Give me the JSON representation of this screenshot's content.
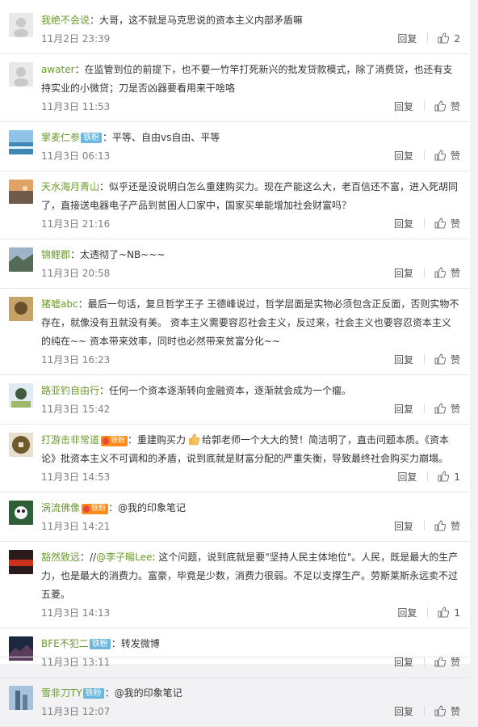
{
  "comments": [
    {
      "user": "我绝不会说",
      "badge": "",
      "vip": "",
      "text": "：大哥，这不就是马克思说的资本主义内部矛盾嘛",
      "time": "11月2日 23:39",
      "reply": "回复",
      "likes": "2"
    },
    {
      "user": "awater",
      "badge": "",
      "vip": "",
      "text": "：在监管到位的前提下，也不要一竹竿打死新兴的批发贷款模式，除了消费贷，也还有支持实业的小微贷；刀是否凶器要看用来干啥咯",
      "time": "11月3日 11:53",
      "reply": "回复",
      "likes": "赞"
    },
    {
      "user": "掌麦仁参",
      "badge": "铁粉",
      "vip": "",
      "text": "：平等、自由vs自由、平等",
      "time": "11月3日 06:13",
      "reply": "回复",
      "likes": "赞"
    },
    {
      "user": "天水海月青山",
      "badge": "",
      "vip": "",
      "text": "：似乎还是没说明白怎么重建购买力。现在产能这么大，老百信还不富，进入死胡同了，直接送电器电子产品到贫困人口家中，国家买单能增加社会财富吗？",
      "time": "11月3日 21:16",
      "reply": "回复",
      "likes": "赞"
    },
    {
      "user": "锦鲤郡",
      "badge": "",
      "vip": "",
      "text": "：太透彻了~NB~~~",
      "time": "11月3日 20:58",
      "reply": "回复",
      "likes": "赞"
    },
    {
      "user": "猪嘘abc",
      "badge": "",
      "vip": "",
      "text": "：最后一句话，复旦哲学王子 王德峰说过，哲学层面是实物必须包含正反面，否则实物不存在，就像没有丑就没有美。 资本主义需要容忍社会主义，反过来，社会主义也要容忍资本主义的纯在~~ 资本带来效率，同时也必然带来贫富分化~~",
      "time": "11月3日 16:23",
      "reply": "回复",
      "likes": "赞"
    },
    {
      "user": "路亚钓自由行",
      "badge": "",
      "vip": "",
      "text": "：任何一个资本逐渐转向金融资本，逐渐就会成为一个瘤。",
      "time": "11月3日 15:42",
      "reply": "回复",
      "likes": "赞"
    },
    {
      "user": "打游击非常道",
      "badge": "",
      "vip": "铁粉",
      "text_a": "：重建购买力",
      "text_b": "给郭老师一个大大的赞！简洁明了，直击问题本质。《资本论》批资本主义不可调和的矛盾，说到底就是财富分配的严重失衡，导致最终社会购买力崩塌。",
      "time": "11月3日 14:53",
      "reply": "回复",
      "likes": "1"
    },
    {
      "user": "涡流佛像",
      "badge": "",
      "vip": "铁粉",
      "text": "：@我的印象笔记",
      "time": "11月3日 14:21",
      "reply": "回复",
      "likes": "赞"
    },
    {
      "user": "豁然致远",
      "badge": "",
      "vip": "",
      "text_a": "：//",
      "mention": "@李子暘Lee",
      "text_b": ": 这个问题，说到底就是要\"坚持人民主体地位\"。人民，既是最大的生产力，也是最大的消费力。富豪，毕竟是少数，消费力很弱。不足以支撑生产。劳斯莱斯永远卖不过五菱。",
      "time": "11月3日 14:13",
      "reply": "回复",
      "likes": "1"
    },
    {
      "user": "BFE不犯二",
      "badge": "铁粉",
      "vip": "",
      "text": "：转发微博",
      "time": "11月3日 13:11",
      "reply": "回复",
      "likes": "赞"
    },
    {
      "user": "雪非刀TY",
      "badge": "铁粉",
      "vip": "",
      "text": "：@我的印象笔记",
      "time": "11月3日 12:07",
      "reply": "回复",
      "likes": "赞"
    }
  ],
  "colors": {
    "username": "#6b9a2b",
    "badge": "#6cb7e0",
    "vip": "#ff8c1a"
  },
  "icons": {
    "like": "thumbs-up-icon",
    "emoji": "thumbs-up-emoji-icon",
    "vip": "vip-fan-badge-icon"
  }
}
